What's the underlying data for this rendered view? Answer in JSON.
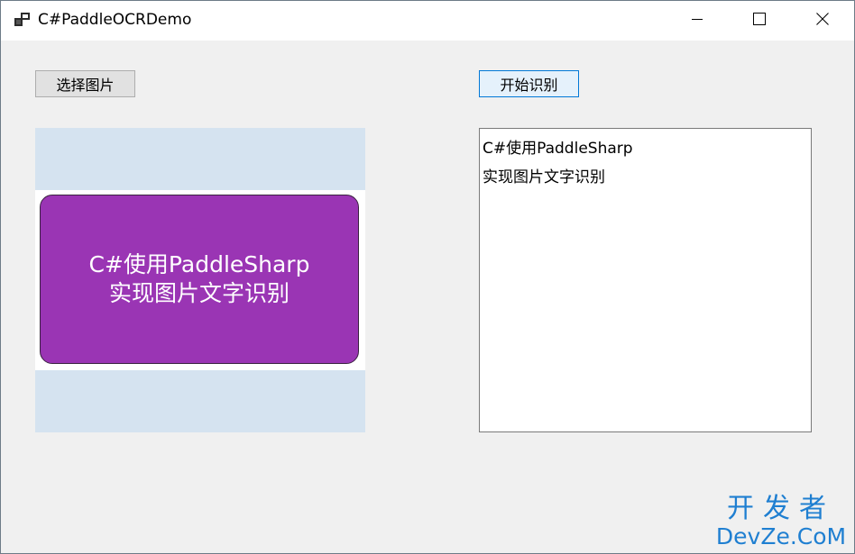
{
  "window": {
    "title": "C#PaddleOCRDemo"
  },
  "icons": {
    "app": "app-window-icon",
    "minimize": "minimize-icon",
    "maximize": "maximize-icon",
    "close": "close-icon"
  },
  "buttons": {
    "select_image": "选择图片",
    "start_ocr": "开始识别"
  },
  "picture": {
    "line1": "C#使用PaddleSharp",
    "line2": "实现图片文字识别"
  },
  "result": {
    "lines": [
      "C#使用PaddleSharp",
      "实现图片文字识别"
    ]
  },
  "watermark": {
    "line1": "开发者",
    "line2": "DevZe.CoM"
  },
  "colors": {
    "card_purple": "#9a35b4",
    "picture_bg": "#d5e3f0",
    "watermark_blue": "#1f7fd1",
    "focus_blue": "#0078d7"
  }
}
